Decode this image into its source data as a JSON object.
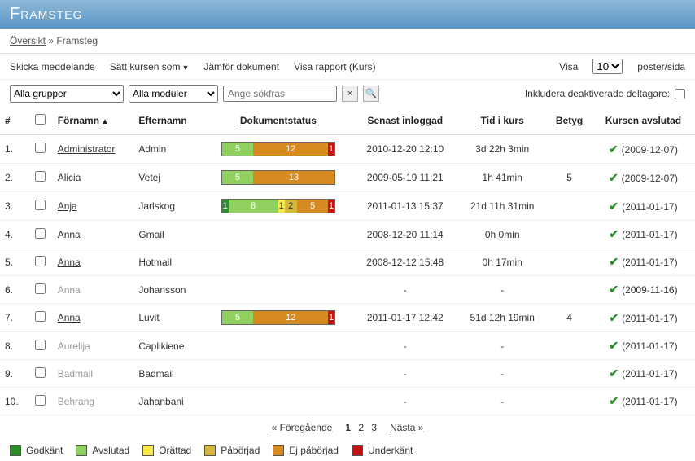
{
  "title": "Framsteg",
  "breadcrumb": {
    "root": "Översikt",
    "sep": "»",
    "current": "Framsteg"
  },
  "toolbar": {
    "send_message": "Skicka meddelande",
    "set_course_as": "Sätt kursen som",
    "compare_documents": "Jämför dokument",
    "show_report": "Visa rapport (Kurs)",
    "visa_label": "Visa",
    "per_page_value": "10",
    "per_page_suffix": "poster/sida"
  },
  "filters": {
    "groups": "Alla grupper",
    "modules": "Alla moduler",
    "search_placeholder": "Ange sökfras",
    "include_deactivated": "Inkludera deaktiverade deltagare:"
  },
  "columns": {
    "num": "#",
    "firstname": "Förnamn",
    "lastname": "Efternamn",
    "docstatus": "Dokumentstatus",
    "lastlogin": "Senast inloggad",
    "timeincourse": "Tid i kurs",
    "grade": "Betyg",
    "completed": "Kursen avslutad"
  },
  "rows": [
    {
      "num": "1.",
      "first": "Administrator",
      "last": "Admin",
      "link": true,
      "status": [
        [
          "c-avslutad",
          "5"
        ],
        [
          "c-ejpaborjad",
          "12"
        ],
        [
          "c-underkant",
          "1"
        ]
      ],
      "login": "2010-12-20 12:10",
      "time": "3d 22h 3min",
      "grade": "",
      "done": "(2009-12-07)"
    },
    {
      "num": "2.",
      "first": "Alicia",
      "last": "Vetej",
      "link": true,
      "status": [
        [
          "c-avslutad",
          "5"
        ],
        [
          "c-ejpaborjad",
          "13"
        ]
      ],
      "login": "2009-05-19 11:21",
      "time": "1h 41min",
      "grade": "5",
      "done": "(2009-12-07)"
    },
    {
      "num": "3.",
      "first": "Anja",
      "last": "Jarlskog",
      "link": true,
      "status": [
        [
          "c-godkant",
          "1"
        ],
        [
          "c-avslutad",
          "8"
        ],
        [
          "c-orattad",
          "1"
        ],
        [
          "c-paborjad",
          "2"
        ],
        [
          "c-ejpaborjad",
          "5"
        ],
        [
          "c-underkant",
          "1"
        ]
      ],
      "login": "2011-01-13 15:37",
      "time": "21d 11h 31min",
      "grade": "",
      "done": "(2011-01-17)"
    },
    {
      "num": "4.",
      "first": "Anna",
      "last": "Gmail",
      "link": true,
      "status": null,
      "login": "2008-12-20 11:14",
      "time": "0h 0min",
      "grade": "",
      "done": "(2011-01-17)"
    },
    {
      "num": "5.",
      "first": "Anna",
      "last": "Hotmail",
      "link": true,
      "status": null,
      "login": "2008-12-12 15:48",
      "time": "0h 17min",
      "grade": "",
      "done": "(2011-01-17)"
    },
    {
      "num": "6.",
      "first": "Anna",
      "last": "Johansson",
      "link": false,
      "status": null,
      "login": "-",
      "time": "-",
      "grade": "",
      "done": "(2009-11-16)"
    },
    {
      "num": "7.",
      "first": "Anna",
      "last": "Luvit",
      "link": true,
      "status": [
        [
          "c-avslutad",
          "5"
        ],
        [
          "c-ejpaborjad",
          "12"
        ],
        [
          "c-underkant",
          "1"
        ]
      ],
      "login": "2011-01-17 12:42",
      "time": "51d 12h 19min",
      "grade": "4",
      "done": "(2011-01-17)"
    },
    {
      "num": "8.",
      "first": "Aurelija",
      "last": "Caplikiene",
      "link": false,
      "status": null,
      "login": "-",
      "time": "-",
      "grade": "",
      "done": "(2011-01-17)"
    },
    {
      "num": "9.",
      "first": "Badmail",
      "last": "Badmail",
      "link": false,
      "status": null,
      "login": "-",
      "time": "-",
      "grade": "",
      "done": "(2011-01-17)"
    },
    {
      "num": "10.",
      "first": "Behrang",
      "last": "Jahanbani",
      "link": false,
      "status": null,
      "login": "-",
      "time": "-",
      "grade": "",
      "done": "(2011-01-17)"
    }
  ],
  "pagination": {
    "prev": "« Föregående",
    "pages": [
      "1",
      "2",
      "3"
    ],
    "next": "Nästa »"
  },
  "legend": {
    "godkant": "Godkänt",
    "avslutad": "Avslutad",
    "orattad": "Orättad",
    "paborjad": "Påbörjad",
    "ejpaborjad": "Ej påbörjad",
    "underkant": "Underkänt"
  }
}
